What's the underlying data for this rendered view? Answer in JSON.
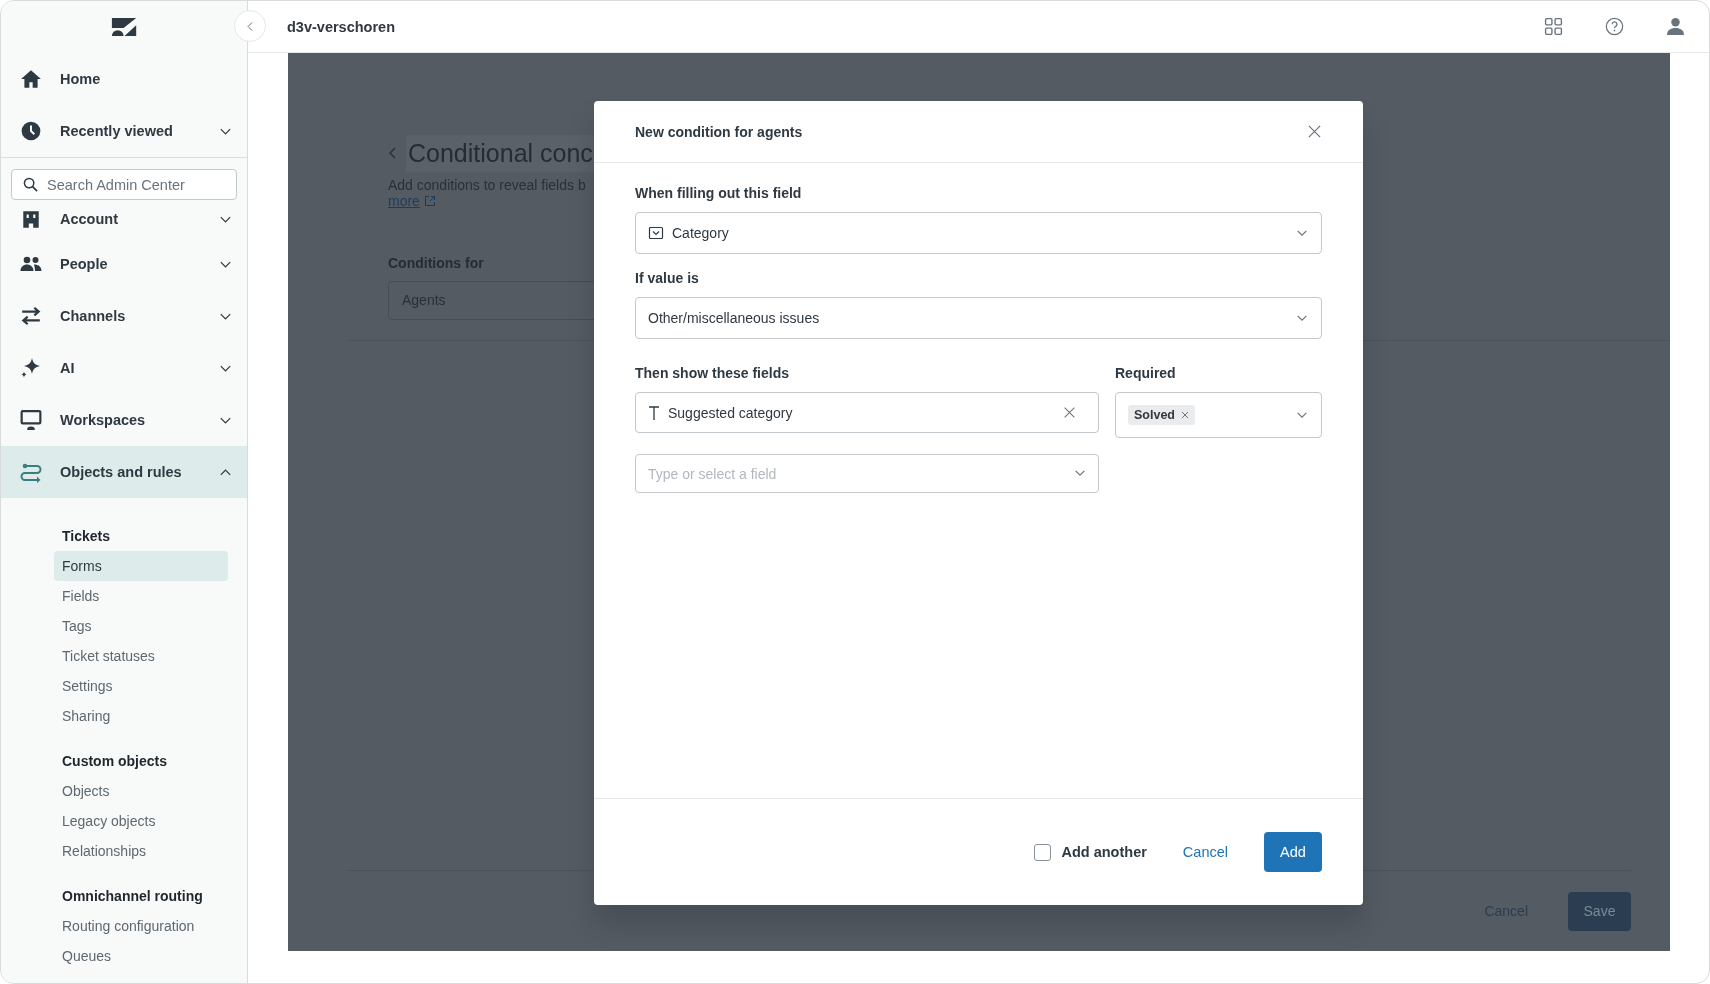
{
  "top_bar": {
    "workspace": "d3v-verschoren"
  },
  "sidebar": {
    "nav_top": [
      {
        "label": "Home",
        "kind": "link",
        "selected": false
      },
      {
        "label": "Recently viewed",
        "kind": "group",
        "expanded": false,
        "selected": false
      }
    ],
    "search": {
      "placeholder": "Search Admin Center"
    },
    "nav": [
      {
        "label": "Account",
        "kind": "group",
        "expanded": false,
        "selected": false
      },
      {
        "label": "People",
        "kind": "group",
        "expanded": false,
        "selected": false
      },
      {
        "label": "Channels",
        "kind": "group",
        "expanded": false,
        "selected": false
      },
      {
        "label": "AI",
        "kind": "group",
        "expanded": false,
        "selected": false
      },
      {
        "label": "Workspaces",
        "kind": "group",
        "expanded": false,
        "selected": false
      },
      {
        "label": "Objects and rules",
        "kind": "group",
        "expanded": true,
        "selected": true
      }
    ],
    "sections": [
      {
        "title": "Tickets",
        "items": [
          {
            "label": "Forms",
            "selected": true
          },
          {
            "label": "Fields",
            "selected": false
          },
          {
            "label": "Tags",
            "selected": false
          },
          {
            "label": "Ticket statuses",
            "selected": false
          },
          {
            "label": "Settings",
            "selected": false
          },
          {
            "label": "Sharing",
            "selected": false
          }
        ]
      },
      {
        "title": "Custom objects",
        "items": [
          {
            "label": "Objects",
            "selected": false
          },
          {
            "label": "Legacy objects",
            "selected": false
          },
          {
            "label": "Relationships",
            "selected": false
          }
        ]
      },
      {
        "title": "Omnichannel routing",
        "items": [
          {
            "label": "Routing configuration",
            "selected": false
          },
          {
            "label": "Queues",
            "selected": false
          }
        ]
      }
    ]
  },
  "page": {
    "title": "Conditional conc",
    "description": "Add conditions to reveal fields b",
    "link": "more",
    "conditions_label": "Conditions for",
    "conditions_value": "Agents",
    "cancel": "Cancel",
    "save": "Save"
  },
  "modal": {
    "title": "New condition for agents",
    "trigger_field": {
      "label": "When filling out this field",
      "value": "Category"
    },
    "value_field": {
      "label": "If value is",
      "value": "Other/miscellaneous issues"
    },
    "show_fields": {
      "label": "Then show these fields",
      "items": [
        {
          "value": "Suggested category"
        }
      ],
      "placeholder": "Type or select a field"
    },
    "required": {
      "label": "Required",
      "tags": [
        "Solved"
      ]
    },
    "add_another": {
      "label": "Add another",
      "checked": false
    },
    "cancel": "Cancel",
    "submit": "Add"
  }
}
